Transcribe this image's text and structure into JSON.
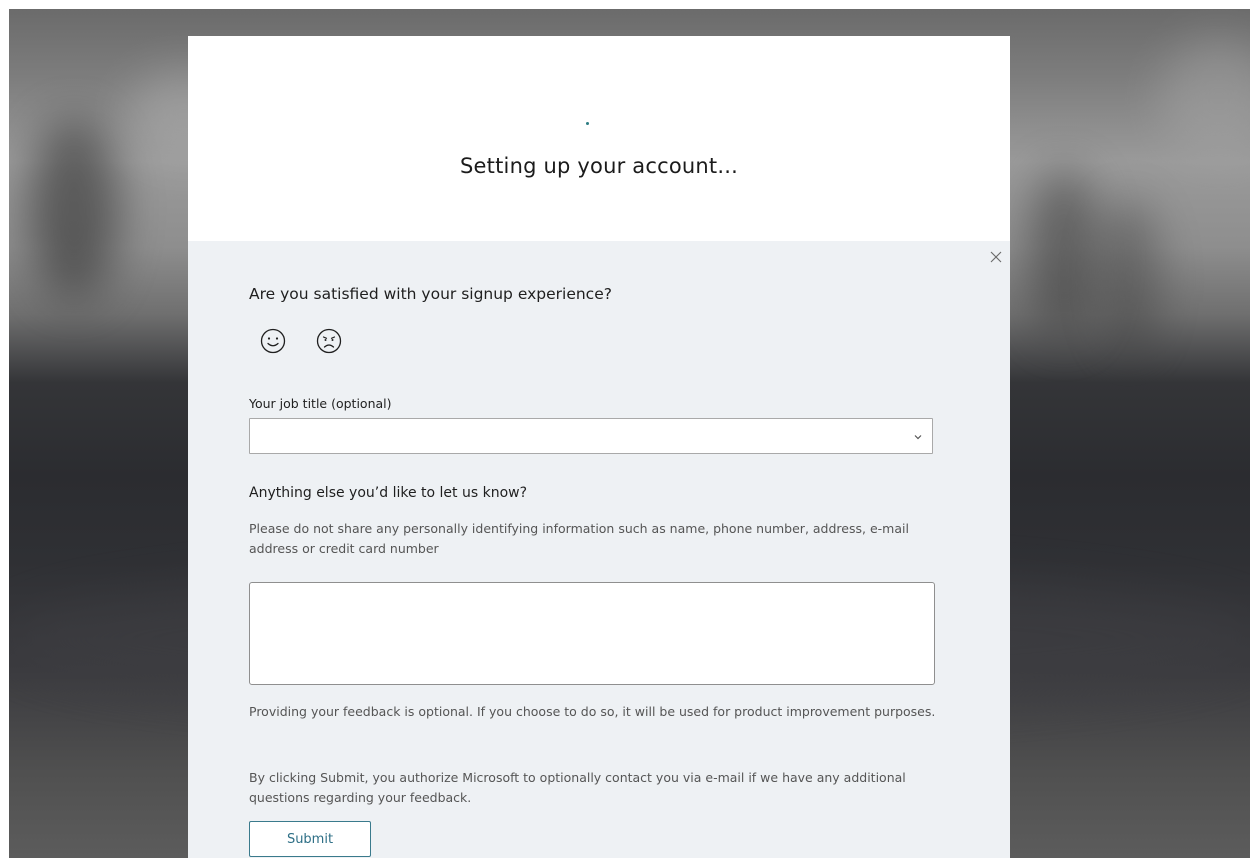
{
  "header": {
    "title": "Setting up your account..."
  },
  "feedback": {
    "question": "Are you satisfied with your signup experience?",
    "smileys": [
      {
        "icon": "smiley-happy-icon"
      },
      {
        "icon": "smiley-sad-icon"
      }
    ],
    "job_title": {
      "label": "Your job title (optional)",
      "value": ""
    },
    "anything_else": {
      "title": "Anything else you’d like to let us know?",
      "privacy_note": "Please do not share any personally identifying information such as name, phone number, address, e-mail address or credit card number",
      "comment_value": ""
    },
    "optional_note": "Providing your feedback is optional. If you choose to do so, it will be used for product improvement purposes.",
    "authorize_note": "By clicking Submit, you authorize Microsoft to optionally contact you via e-mail if we have any additional questions regarding your feedback.",
    "submit_label": "Submit"
  },
  "colors": {
    "accent": "#2e6f86",
    "panel_background": "#eef1f4",
    "loading_dot": "#2c7d83"
  }
}
